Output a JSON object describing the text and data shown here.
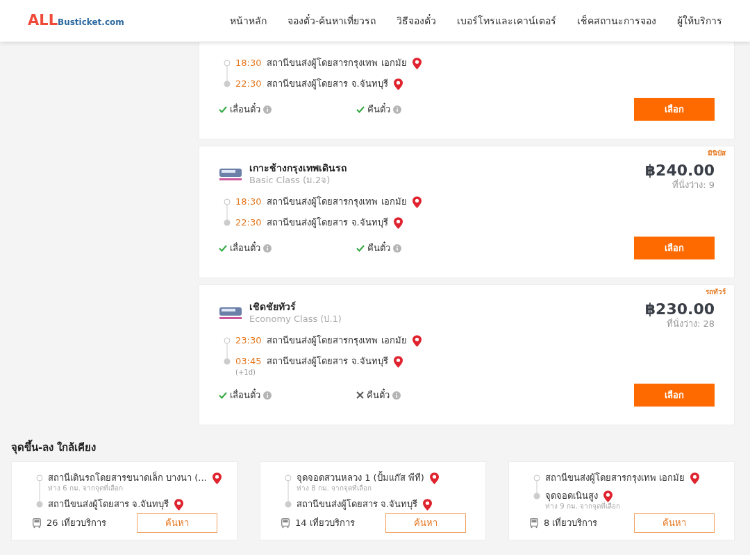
{
  "header": {
    "logo": {
      "mark": "ALL",
      "site": "Busticket.com"
    },
    "nav": [
      "หน้าหลัก",
      "จองตั๋ว-ค้นหาเที่ยวรถ",
      "วิธีจองตั๋ว",
      "เบอร์โทรและเคาน์เตอร์",
      "เช็คสถานะการจอง",
      "ผู้ให้บริการ"
    ]
  },
  "trips": [
    {
      "stops": [
        {
          "time": "18:30",
          "place": "สถานีขนส่งผู้โดยสารกรุงเทพ เอกมัย"
        },
        {
          "time": "22:30",
          "place": "สถานีขนส่งผู้โดยสาร จ.จันทบุรี"
        }
      ],
      "features": [
        {
          "label": "เลื่อนตั๋ว",
          "available": true
        },
        {
          "label": "คืนตั๋ว",
          "available": true
        }
      ],
      "button": "เลือก"
    },
    {
      "tag": "มินิบัส",
      "name": "เกาะช้างกรุงเทพเดินรถ",
      "class": "Basic Class (ม.2จ)",
      "price": "฿240.00",
      "seats": "ที่นั่งว่าง: 9",
      "stops": [
        {
          "time": "18:30",
          "place": "สถานีขนส่งผู้โดยสารกรุงเทพ เอกมัย"
        },
        {
          "time": "22:30",
          "place": "สถานีขนส่งผู้โดยสาร จ.จันทบุรี"
        }
      ],
      "features": [
        {
          "label": "เลื่อนตั๋ว",
          "available": true
        },
        {
          "label": "คืนตั๋ว",
          "available": true
        }
      ],
      "button": "เลือก"
    },
    {
      "tag": "รถทัวร์",
      "name": "เชิดชัยทัวร์",
      "class": "Economy Class (ป.1)",
      "price": "฿230.00",
      "seats": "ที่นั่งว่าง: 28",
      "stops": [
        {
          "time": "23:30",
          "place": "สถานีขนส่งผู้โดยสารกรุงเทพ เอกมัย"
        },
        {
          "time": "03:45",
          "place": "สถานีขนส่งผู้โดยสาร จ.จันทบุรี",
          "note": "(+1d)"
        }
      ],
      "features": [
        {
          "label": "เลื่อนตั๋ว",
          "available": true
        },
        {
          "label": "คืนตั๋ว",
          "available": false
        }
      ],
      "button": "เลือก"
    }
  ],
  "nearby": {
    "title": "จุดขึ้น-ลง ใกล้เคียง",
    "routes": [
      {
        "stops": [
          {
            "place": "สถานีเดินรถโดยสารขนาดเล็ก บางนา (...",
            "distance": "ห่าง 6 กม. จากจุดที่เลือก"
          },
          {
            "place": "สถานีขนส่งผู้โดยสาร จ.จันทบุรี"
          }
        ],
        "trips": "26 เที่ยวบริการ",
        "button": "ค้นหา"
      },
      {
        "stops": [
          {
            "place": "จุดจอดสวนหลวง 1 (ปั้มแก๊ส พีที)",
            "distance": "ห่าง 8 กม. จากจุดที่เลือก"
          },
          {
            "place": "สถานีขนส่งผู้โดยสาร จ.จันทบุรี"
          }
        ],
        "trips": "14 เที่ยวบริการ",
        "button": "ค้นหา"
      },
      {
        "stops": [
          {
            "place": "สถานีขนส่งผู้โดยสารกรุงเทพ เอกมัย"
          },
          {
            "place": "จุดจอดเนินสูง",
            "distance": "ห่าง 9 กม. จากจุดที่เลือก"
          }
        ],
        "trips": "8 เที่ยวบริการ",
        "button": "ค้นหา"
      }
    ]
  }
}
